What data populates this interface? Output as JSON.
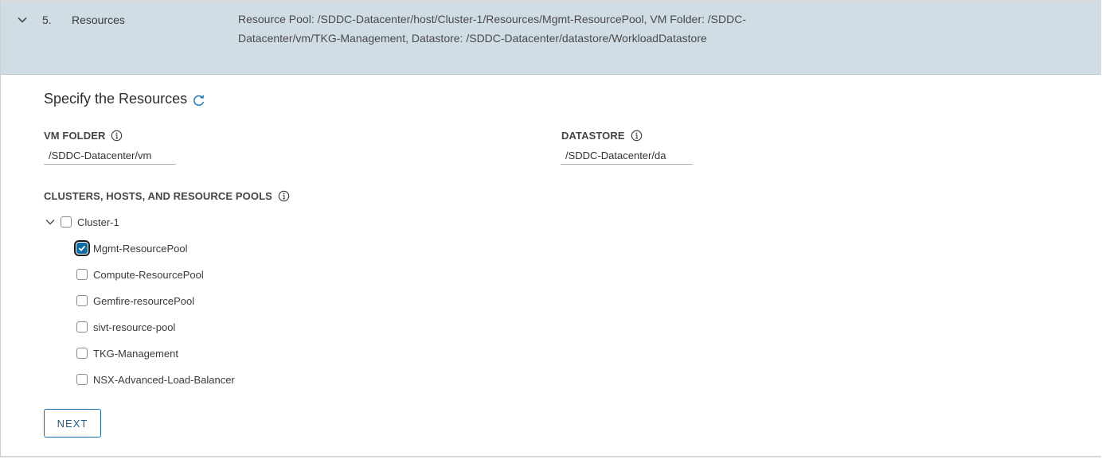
{
  "step": {
    "number": "5.",
    "title": "Resources",
    "summary": "Resource Pool: /SDDC-Datacenter/host/Cluster-1/Resources/Mgmt-ResourcePool, VM Folder: /SDDC-Datacenter/vm/TKG-Management, Datastore: /SDDC-Datacenter/datastore/WorkloadDatastore",
    "expanded": true
  },
  "section": {
    "title": "Specify the Resources"
  },
  "vm_folder": {
    "label": "VM FOLDER",
    "value": "/SDDC-Datacenter/vm"
  },
  "datastore": {
    "label": "DATASTORE",
    "value": "/SDDC-Datacenter/da"
  },
  "resources": {
    "label": "CLUSTERS, HOSTS, AND RESOURCE POOLS",
    "cluster": {
      "name": "Cluster-1",
      "checked": false,
      "expanded": true
    },
    "pools": [
      {
        "name": "Mgmt-ResourcePool",
        "checked": true
      },
      {
        "name": "Compute-ResourcePool",
        "checked": false
      },
      {
        "name": "Gemfire-resourcePool",
        "checked": false
      },
      {
        "name": "sivt-resource-pool",
        "checked": false
      },
      {
        "name": "TKG-Management",
        "checked": false
      },
      {
        "name": "NSX-Advanced-Load-Balancer",
        "checked": false
      }
    ]
  },
  "actions": {
    "next_label": "NEXT"
  },
  "colors": {
    "header_bg": "#d1dde4",
    "accent": "#0f6ba3",
    "button_text": "#1a5f8f"
  },
  "icons": {
    "expand": "chevron-down-icon",
    "refresh": "refresh-icon",
    "info": "info-icon",
    "check": "checkmark-icon"
  }
}
